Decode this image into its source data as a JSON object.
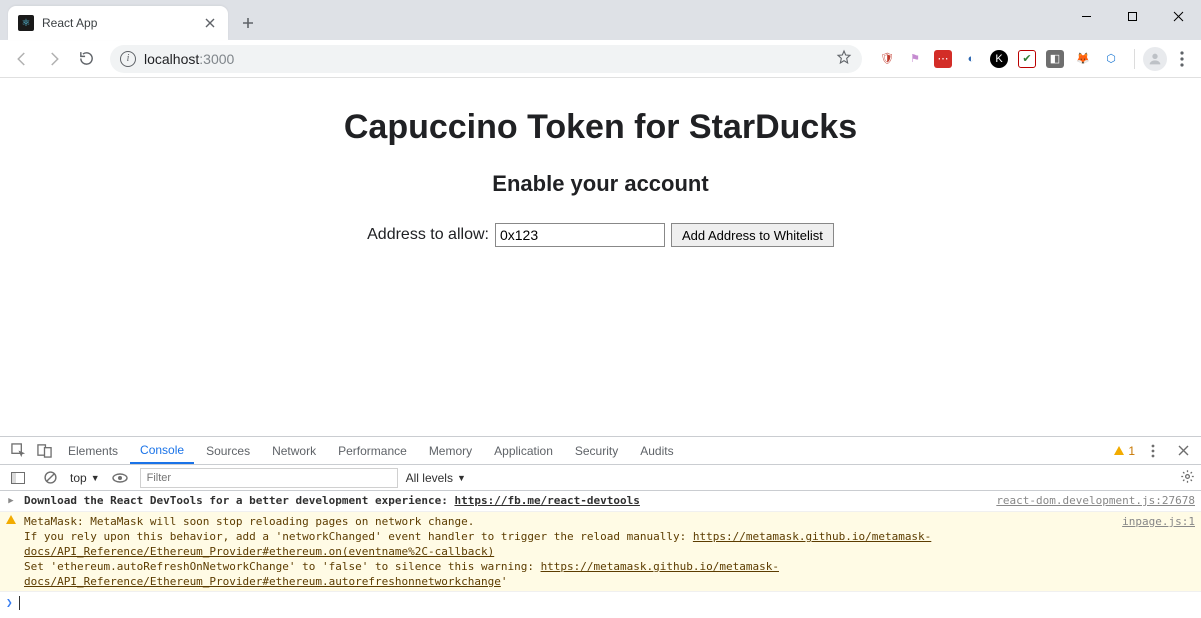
{
  "window": {
    "tab_title": "React App",
    "new_tab_tooltip": "New Tab"
  },
  "toolbar": {
    "url_host": "localhost",
    "url_port": ":3000",
    "extensions": [
      {
        "name": "ublock",
        "bg": "transparent",
        "glyph": "🛡",
        "color": "#c0392b"
      },
      {
        "name": "flag",
        "bg": "transparent",
        "glyph": "⚑",
        "color": "#c58bd0"
      },
      {
        "name": "lastpass",
        "bg": "#d32d27",
        "glyph": "⋯",
        "color": "#fff"
      },
      {
        "name": "circle-g",
        "bg": "transparent",
        "glyph": "◐",
        "color": "#2a66b1"
      },
      {
        "name": "k-badge",
        "bg": "#000",
        "glyph": "K",
        "color": "#fff",
        "round": true
      },
      {
        "name": "checkmark",
        "bg": "#fff",
        "glyph": "✔",
        "color": "#2e7d32",
        "border": "#b00"
      },
      {
        "name": "cube",
        "bg": "#6e6e6e",
        "glyph": "◧",
        "color": "#fff"
      },
      {
        "name": "metamask",
        "bg": "transparent",
        "glyph": "🦊",
        "color": "#e2761b"
      },
      {
        "name": "hex",
        "bg": "transparent",
        "glyph": "⬡",
        "color": "#1976d2"
      }
    ]
  },
  "page": {
    "title": "Capuccino Token for StarDucks",
    "subtitle": "Enable your account",
    "label": "Address to allow:",
    "input_value": "0x123",
    "button_label": "Add Address to Whitelist"
  },
  "devtools": {
    "tabs": [
      "Elements",
      "Console",
      "Sources",
      "Network",
      "Performance",
      "Memory",
      "Application",
      "Security",
      "Audits"
    ],
    "active_tab": "Console",
    "warn_count": "1",
    "context": "top",
    "filter_placeholder": "Filter",
    "levels_label": "All levels",
    "logs": [
      {
        "type": "info",
        "text": "Download the React DevTools for a better development experience: ",
        "link": "https://fb.me/react-devtools",
        "source": "react-dom.development.js:27678"
      },
      {
        "type": "warn",
        "pre1": "MetaMask: MetaMask will soon stop reloading pages on network change.\nIf you rely upon this behavior, add a 'networkChanged' event handler to trigger the reload manually: ",
        "link1": "https://metamask.github.io/metamask-docs/API_Reference/Ethereum_Provider#ethereum.on(eventname%2C-callback)",
        "pre2": "\nSet 'ethereum.autoRefreshOnNetworkChange' to 'false' to silence this warning: ",
        "link2": "https://metamask.github.io/metamask-docs/API_Reference/Ethereum_Provider#ethereum.autorefreshonnetworkchange",
        "post": "'",
        "source": "inpage.js:1"
      }
    ]
  }
}
